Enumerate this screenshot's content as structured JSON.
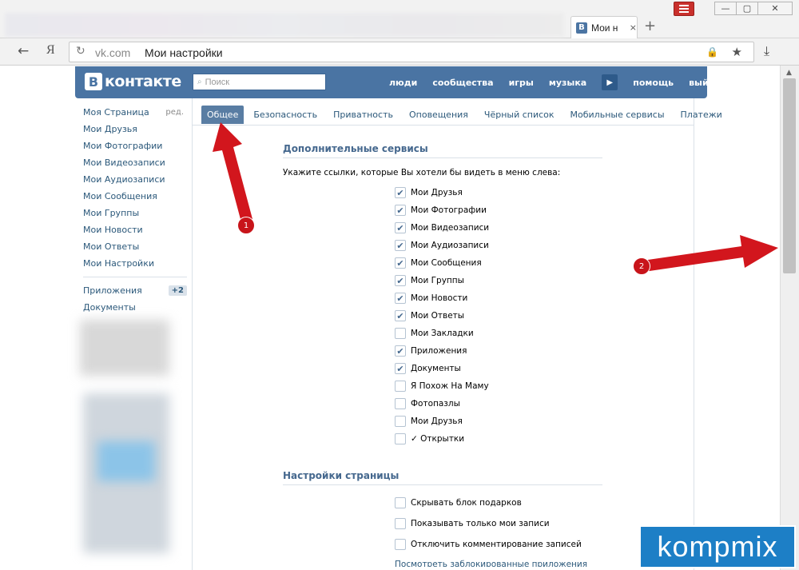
{
  "browser": {
    "tab_logo": "В",
    "tab_title": "Мои н",
    "tab_close": "×",
    "new_tab": "+",
    "url_domain": "vk.com",
    "url_title": "Мои настройки",
    "back_glyph": "←",
    "ya_glyph": "Я",
    "reload_glyph": "↻",
    "lock_glyph": "🔒",
    "star_glyph": "★",
    "download_glyph": "⤓",
    "min_glyph": "—",
    "max_glyph": "▢",
    "close_glyph": "✕"
  },
  "vk": {
    "logo_mark": "В",
    "logo_text": "контакте",
    "search_placeholder": "Поиск",
    "nav": [
      "люди",
      "сообщества",
      "игры",
      "музыка",
      "помощь",
      "выйти"
    ],
    "left_menu": [
      {
        "label": "Моя Страница",
        "extra": "ред."
      },
      {
        "label": "Мои Друзья"
      },
      {
        "label": "Мои Фотографии"
      },
      {
        "label": "Мои Видеозаписи"
      },
      {
        "label": "Мои Аудиозаписи"
      },
      {
        "label": "Мои Сообщения"
      },
      {
        "label": "Мои Группы"
      },
      {
        "label": "Мои Новости"
      },
      {
        "label": "Мои Ответы"
      },
      {
        "label": "Мои Настройки"
      }
    ],
    "left_menu_extra": [
      {
        "label": "Приложения",
        "badge": "+2"
      },
      {
        "label": "Документы"
      }
    ],
    "tabs": [
      "Общее",
      "Безопасность",
      "Приватность",
      "Оповещения",
      "Чёрный список",
      "Мобильные сервисы",
      "Платежи"
    ],
    "section1_title": "Дополнительные сервисы",
    "section1_hint": "Укажите ссылки, которые Вы хотели бы видеть в меню слева:",
    "services": [
      {
        "label": "Мои Друзья",
        "checked": true
      },
      {
        "label": "Мои Фотографии",
        "checked": true
      },
      {
        "label": "Мои Видеозаписи",
        "checked": true
      },
      {
        "label": "Мои Аудиозаписи",
        "checked": true
      },
      {
        "label": "Мои Сообщения",
        "checked": true
      },
      {
        "label": "Мои Группы",
        "checked": true
      },
      {
        "label": "Мои Новости",
        "checked": true
      },
      {
        "label": "Мои Ответы",
        "checked": true
      },
      {
        "label": "Мои Закладки",
        "checked": false
      },
      {
        "label": "Приложения",
        "checked": true
      },
      {
        "label": "Документы",
        "checked": true
      },
      {
        "label": "Я Похож На Маму",
        "checked": false
      },
      {
        "label": "Фотопазлы",
        "checked": false
      },
      {
        "label": "Мои Друзья",
        "checked": false
      },
      {
        "label": "✓ Открытки",
        "checked": false
      }
    ],
    "section2_title": "Настройки страницы",
    "page_settings": [
      {
        "label": "Скрывать блок подарков",
        "checked": false
      },
      {
        "label": "Показывать только мои записи",
        "checked": false
      },
      {
        "label": "Отключить комментирование записей",
        "checked": false
      }
    ],
    "cut_link": "Посмотреть заблокированные приложения"
  },
  "annotations": {
    "marker1": "1",
    "marker2": "2",
    "arrow_color": "#d2161d",
    "watermark": "kompmix"
  },
  "colors": {
    "vk_blue": "#4a74a3",
    "vk_link": "#2b587a",
    "tab_active": "#597da3"
  }
}
